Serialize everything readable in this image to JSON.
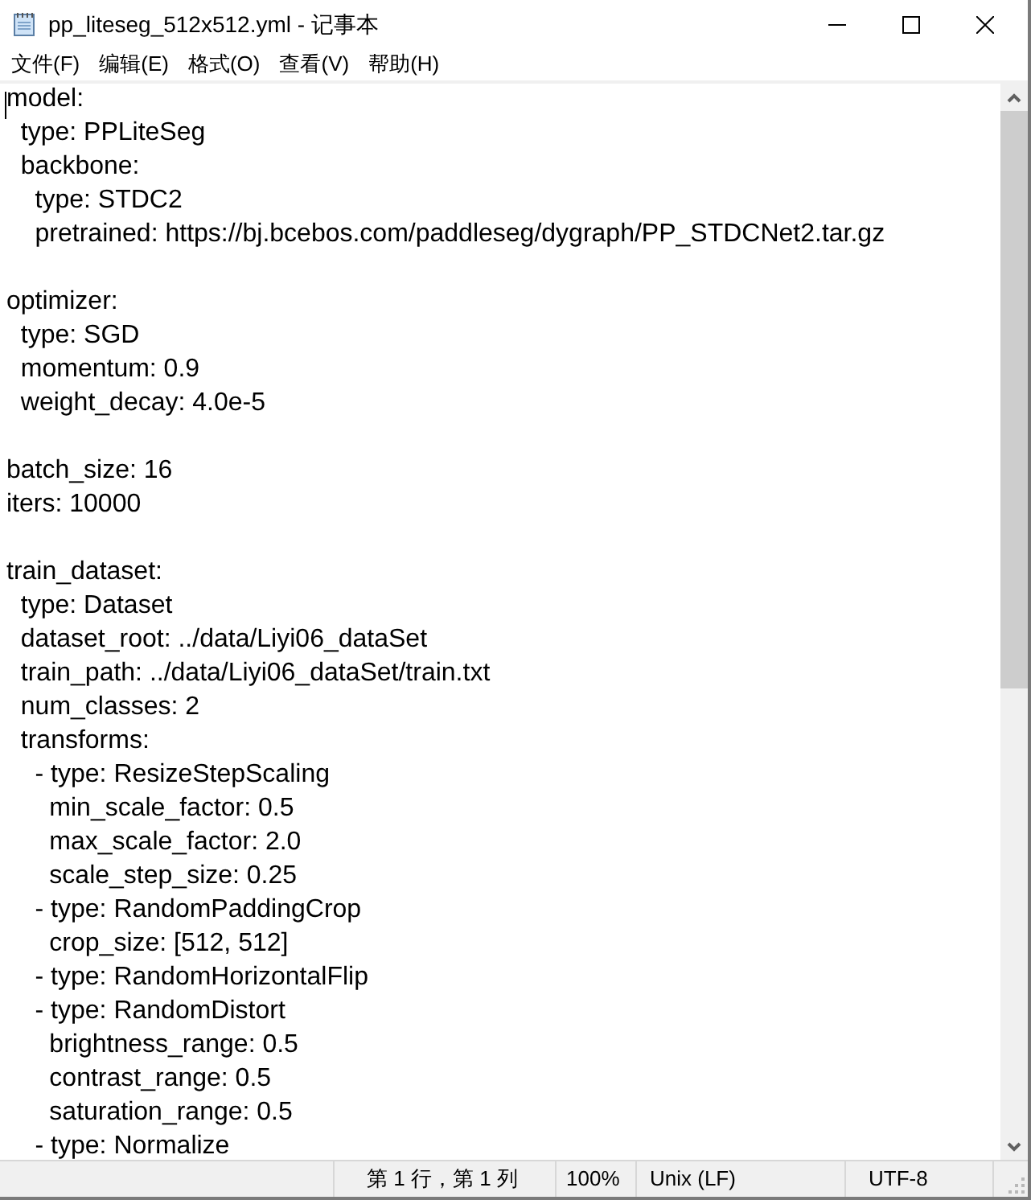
{
  "window": {
    "title": "pp_liteseg_512x512.yml - 记事本"
  },
  "menu": [
    "文件(F)",
    "编辑(E)",
    "格式(O)",
    "查看(V)",
    "帮助(H)"
  ],
  "blocks": [
    [
      "model:",
      "  type: PPLiteSeg",
      "  backbone:",
      "    type: STDC2",
      "    pretrained: https://bj.bcebos.com/paddleseg/dygraph/PP_STDCNet2.tar.gz"
    ],
    [
      "optimizer:",
      "  type: SGD",
      "  momentum: 0.9",
      "  weight_decay: 4.0e-5"
    ],
    [
      "batch_size: 16",
      "iters: 10000"
    ],
    [
      "train_dataset:",
      "  type: Dataset",
      "  dataset_root: ../data/Liyi06_dataSet",
      "  train_path: ../data/Liyi06_dataSet/train.txt",
      "  num_classes: 2",
      "  transforms:",
      "    - type: ResizeStepScaling",
      "      min_scale_factor: 0.5",
      "      max_scale_factor: 2.0",
      "      scale_step_size: 0.25",
      "    - type: RandomPaddingCrop",
      "      crop_size: [512, 512]",
      "    - type: RandomHorizontalFlip",
      "    - type: RandomDistort",
      "      brightness_range: 0.5",
      "      contrast_range: 0.5",
      "      saturation_range: 0.5",
      "    - type: Normalize"
    ]
  ],
  "status_bar": [
    "第 1 行，第 1 列",
    "100%",
    "Unix (LF)",
    "UTF-8"
  ]
}
